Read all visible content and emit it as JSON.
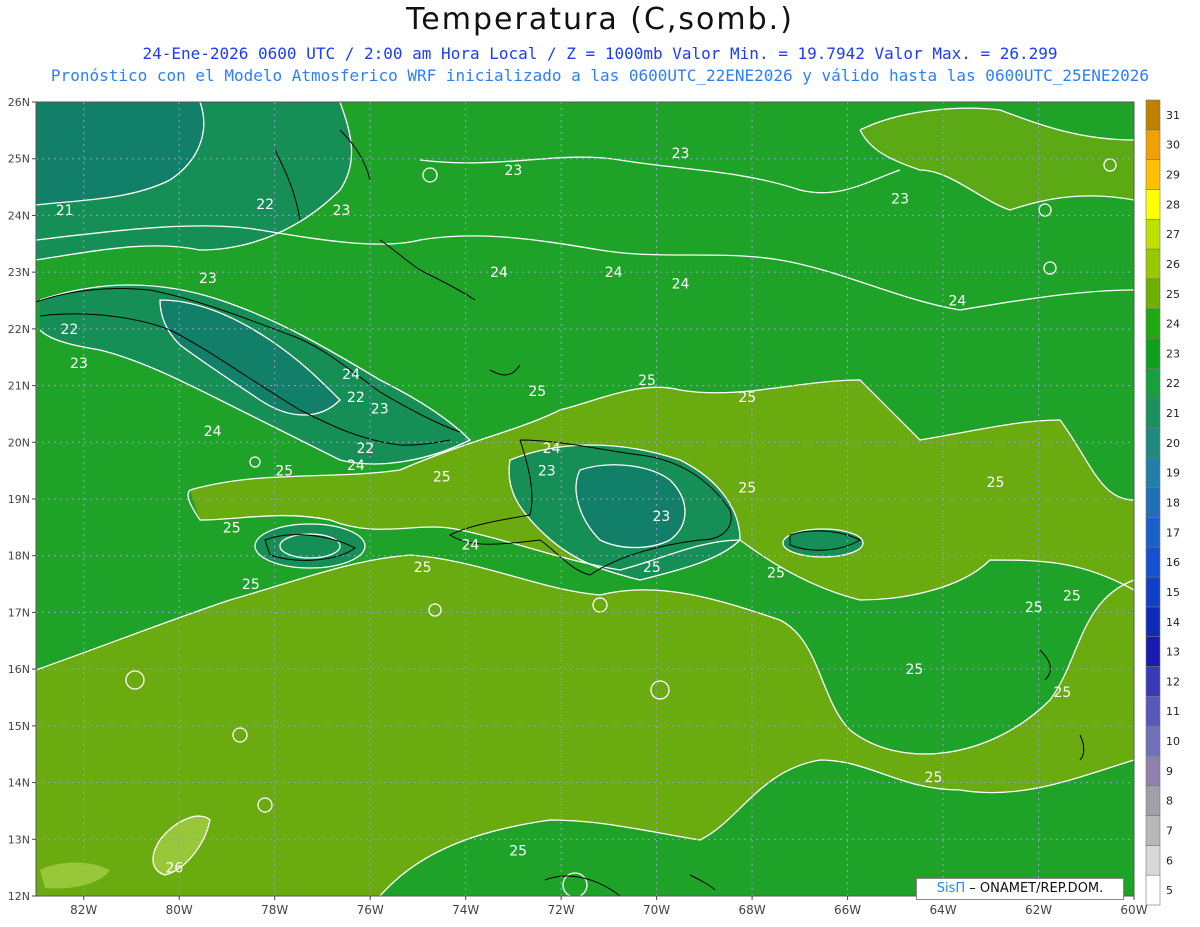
{
  "title": "Temperatura (C,somb.)",
  "subtitle_line1": "24-Ene-2026  0600 UTC / 2:00 am Hora Local / Z = 1000mb    Valor Min. = 19.7942  Valor Max. = 26.299",
  "subtitle_line2": "Pronóstico con el Modelo Atmosferico WRF inicializado a las 0600UTC_22ENE2026 y válido hasta las  0600UTC_25ENE2026",
  "credit": {
    "brand": "SisΠ",
    "text": " – ONAMET/REP.DOM."
  },
  "chart_data": {
    "type": "heatmap",
    "variable": "Temperatura",
    "units": "C",
    "value_min": 19.7942,
    "value_max": 26.299,
    "x_axis": {
      "ticks": [
        "82W",
        "80W",
        "78W",
        "76W",
        "74W",
        "72W",
        "70W",
        "68W",
        "66W",
        "64W",
        "62W",
        "60W"
      ],
      "range": [
        -83,
        -60
      ]
    },
    "y_axis": {
      "ticks": [
        "12N",
        "13N",
        "14N",
        "15N",
        "16N",
        "17N",
        "18N",
        "19N",
        "20N",
        "21N",
        "22N",
        "23N",
        "24N",
        "25N",
        "26N"
      ],
      "range": [
        12,
        26
      ]
    },
    "colorbar": {
      "levels": [
        "5",
        "6",
        "7",
        "8",
        "9",
        "10",
        "11",
        "12",
        "13",
        "14",
        "15",
        "16",
        "17",
        "18",
        "19",
        "20",
        "21",
        "22",
        "23",
        "24",
        "25",
        "26",
        "27",
        "28",
        "29",
        "30",
        "31"
      ],
      "colors": [
        "#ffffff",
        "#d8d8d8",
        "#b8b8b8",
        "#a0a0a8",
        "#9080b0",
        "#7070b8",
        "#5858b8",
        "#3a3ab8",
        "#1a1ab0",
        "#0f2ab8",
        "#1040c8",
        "#1450d0",
        "#1a60c8",
        "#2070b8",
        "#2080a8",
        "#208a80",
        "#1a9060",
        "#18a040",
        "#10a020",
        "#20a810",
        "#70b000",
        "#98c800",
        "#c0e000",
        "#ffff00",
        "#ffc000",
        "#f0a000",
        "#c08000"
      ]
    },
    "contour_labels": [
      {
        "text": "21",
        "lon": -82.4,
        "lat": 24.1
      },
      {
        "text": "22",
        "lon": -78.2,
        "lat": 24.2
      },
      {
        "text": "23",
        "lon": -76.6,
        "lat": 24.1
      },
      {
        "text": "23",
        "lon": -73.0,
        "lat": 24.8
      },
      {
        "text": "23",
        "lon": -69.5,
        "lat": 25.1
      },
      {
        "text": "23",
        "lon": -64.9,
        "lat": 24.3
      },
      {
        "text": "23",
        "lon": -79.4,
        "lat": 22.9
      },
      {
        "text": "22",
        "lon": -82.3,
        "lat": 22.0
      },
      {
        "text": "23",
        "lon": -82.1,
        "lat": 21.4
      },
      {
        "text": "24",
        "lon": -73.3,
        "lat": 23.0
      },
      {
        "text": "24",
        "lon": -70.9,
        "lat": 23.0
      },
      {
        "text": "24",
        "lon": -69.5,
        "lat": 22.8
      },
      {
        "text": "24",
        "lon": -63.7,
        "lat": 22.5
      },
      {
        "text": "24",
        "lon": -76.4,
        "lat": 21.2
      },
      {
        "text": "22",
        "lon": -76.3,
        "lat": 20.8
      },
      {
        "text": "23",
        "lon": -75.8,
        "lat": 20.6
      },
      {
        "text": "24",
        "lon": -79.3,
        "lat": 20.2
      },
      {
        "text": "22",
        "lon": -76.1,
        "lat": 19.9
      },
      {
        "text": "24",
        "lon": -76.3,
        "lat": 19.6
      },
      {
        "text": "25",
        "lon": -77.8,
        "lat": 19.5
      },
      {
        "text": "25",
        "lon": -72.5,
        "lat": 20.9
      },
      {
        "text": "25",
        "lon": -70.2,
        "lat": 21.1
      },
      {
        "text": "25",
        "lon": -68.1,
        "lat": 20.8
      },
      {
        "text": "24",
        "lon": -72.2,
        "lat": 19.9
      },
      {
        "text": "23",
        "lon": -72.3,
        "lat": 19.5
      },
      {
        "text": "25",
        "lon": -74.5,
        "lat": 19.4
      },
      {
        "text": "23",
        "lon": -69.9,
        "lat": 18.7
      },
      {
        "text": "25",
        "lon": -68.1,
        "lat": 19.2
      },
      {
        "text": "25",
        "lon": -62.9,
        "lat": 19.3
      },
      {
        "text": "25",
        "lon": -78.9,
        "lat": 18.5
      },
      {
        "text": "24",
        "lon": -73.9,
        "lat": 18.2
      },
      {
        "text": "25",
        "lon": -74.9,
        "lat": 17.8
      },
      {
        "text": "25",
        "lon": -70.1,
        "lat": 17.8
      },
      {
        "text": "25",
        "lon": -78.5,
        "lat": 17.5
      },
      {
        "text": "25",
        "lon": -67.5,
        "lat": 17.7
      },
      {
        "text": "25",
        "lon": -62.1,
        "lat": 17.1
      },
      {
        "text": "25",
        "lon": -61.3,
        "lat": 17.3
      },
      {
        "text": "25",
        "lon": -64.6,
        "lat": 16.0
      },
      {
        "text": "25",
        "lon": -61.5,
        "lat": 15.6
      },
      {
        "text": "25",
        "lon": -64.2,
        "lat": 14.1
      },
      {
        "text": "25",
        "lon": -72.9,
        "lat": 12.8
      },
      {
        "text": "26",
        "lon": -80.1,
        "lat": 12.5
      }
    ]
  }
}
